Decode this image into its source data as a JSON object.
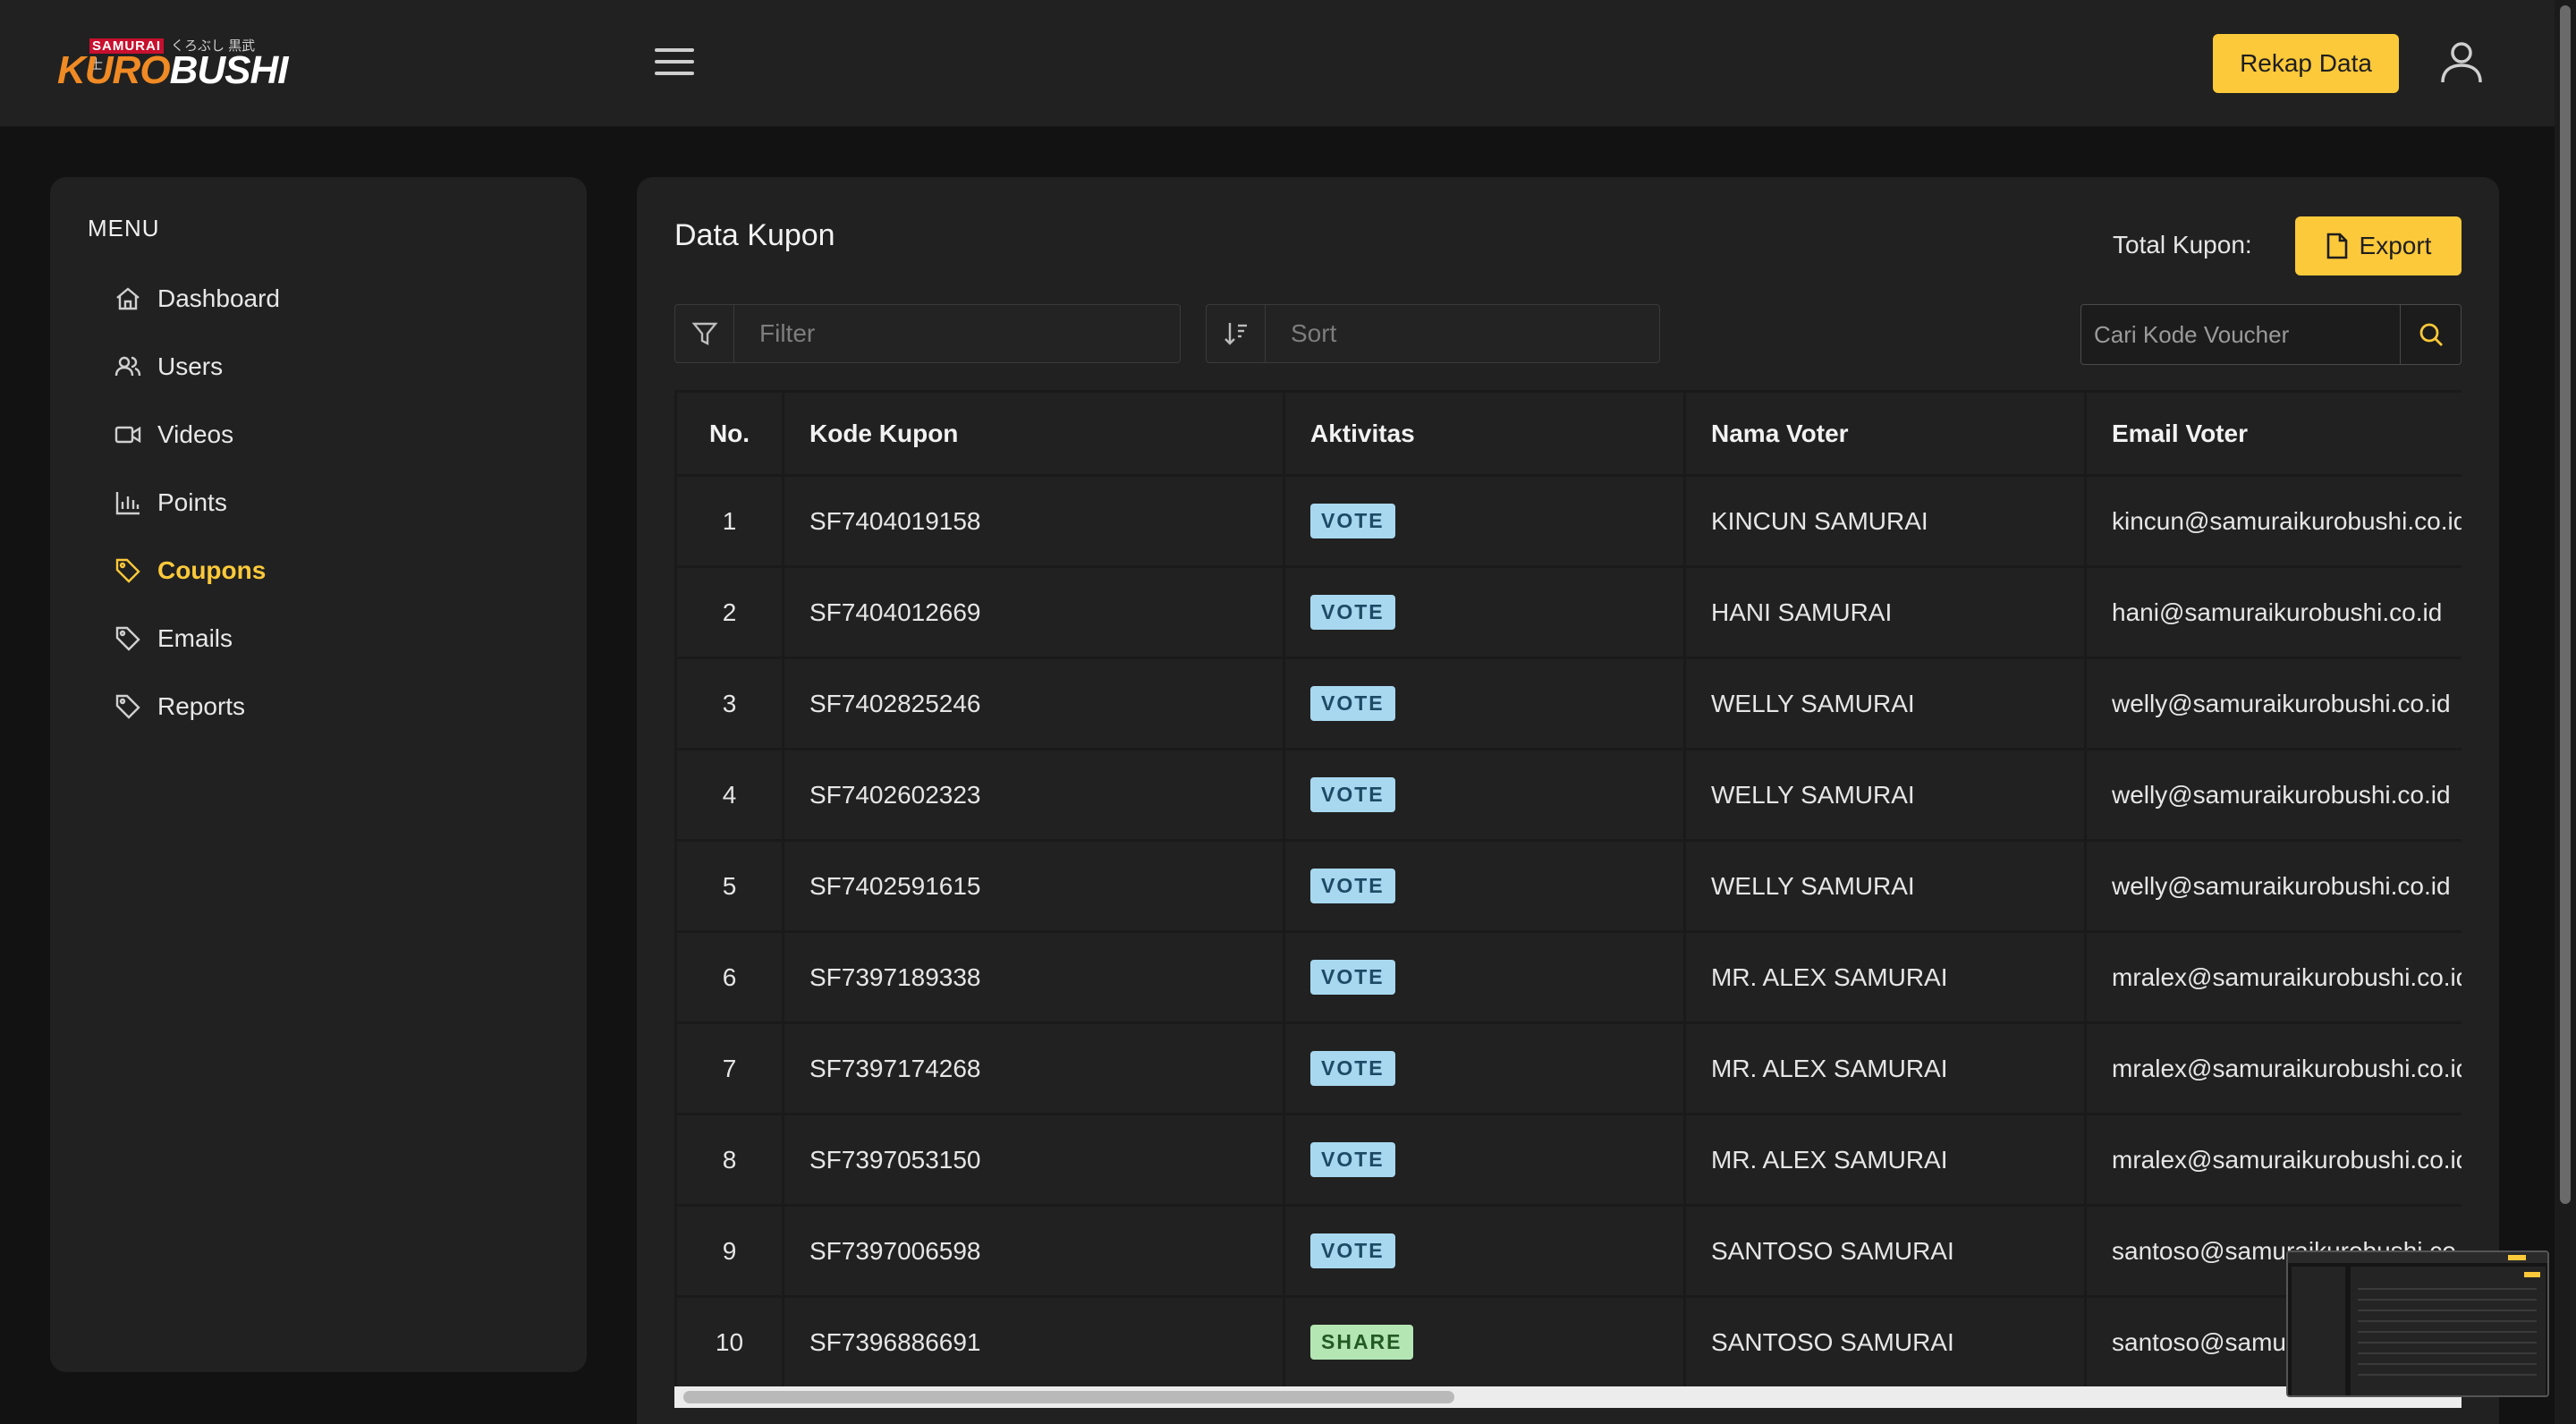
{
  "header": {
    "logo": {
      "samurai": "SAMURAI",
      "japanese": "くろぶし 黒武士",
      "kuro": "KURO",
      "bushi": "BUSHI"
    },
    "rekap_label": "Rekap Data"
  },
  "sidebar": {
    "title": "MENU",
    "items": [
      {
        "label": "Dashboard",
        "icon": "home-icon"
      },
      {
        "label": "Users",
        "icon": "users-icon"
      },
      {
        "label": "Videos",
        "icon": "video-icon"
      },
      {
        "label": "Points",
        "icon": "bar-chart-icon"
      },
      {
        "label": "Coupons",
        "icon": "tag-icon",
        "active": true
      },
      {
        "label": "Emails",
        "icon": "tag-icon"
      },
      {
        "label": "Reports",
        "icon": "tag-icon"
      }
    ]
  },
  "main": {
    "title": "Data Kupon",
    "total_label": "Total Kupon:",
    "export_label": "Export",
    "filter_placeholder": "Filter",
    "sort_placeholder": "Sort",
    "search_placeholder": "Cari Kode Voucher",
    "columns": [
      "No.",
      "Kode Kupon",
      "Aktivitas",
      "Nama Voter",
      "Email Voter"
    ],
    "rows": [
      {
        "no": "1",
        "kode": "SF7404019158",
        "aktivitas": "VOTE",
        "nama": "KINCUN SAMURAI",
        "email": "kincun@samuraikurobushi.co.id"
      },
      {
        "no": "2",
        "kode": "SF7404012669",
        "aktivitas": "VOTE",
        "nama": "HANI SAMURAI",
        "email": "hani@samuraikurobushi.co.id"
      },
      {
        "no": "3",
        "kode": "SF7402825246",
        "aktivitas": "VOTE",
        "nama": "WELLY SAMURAI",
        "email": "welly@samuraikurobushi.co.id"
      },
      {
        "no": "4",
        "kode": "SF7402602323",
        "aktivitas": "VOTE",
        "nama": "WELLY SAMURAI",
        "email": "welly@samuraikurobushi.co.id"
      },
      {
        "no": "5",
        "kode": "SF7402591615",
        "aktivitas": "VOTE",
        "nama": "WELLY SAMURAI",
        "email": "welly@samuraikurobushi.co.id"
      },
      {
        "no": "6",
        "kode": "SF7397189338",
        "aktivitas": "VOTE",
        "nama": "MR. ALEX SAMURAI",
        "email": "mralex@samuraikurobushi.co.id"
      },
      {
        "no": "7",
        "kode": "SF7397174268",
        "aktivitas": "VOTE",
        "nama": "MR. ALEX SAMURAI",
        "email": "mralex@samuraikurobushi.co.id"
      },
      {
        "no": "8",
        "kode": "SF7397053150",
        "aktivitas": "VOTE",
        "nama": "MR. ALEX SAMURAI",
        "email": "mralex@samuraikurobushi.co.id"
      },
      {
        "no": "9",
        "kode": "SF7397006598",
        "aktivitas": "VOTE",
        "nama": "SANTOSO SAMURAI",
        "email": "santoso@samuraikurobushi.co.id"
      },
      {
        "no": "10",
        "kode": "SF7396886691",
        "aktivitas": "SHARE",
        "nama": "SANTOSO SAMURAI",
        "email": "santoso@samuraikurobushi.co.id"
      }
    ]
  },
  "colors": {
    "accent": "#fcc93a",
    "background": "#121212",
    "panel": "#212121",
    "vote_badge": "#a8d8f0",
    "share_badge": "#b4e6b4"
  }
}
